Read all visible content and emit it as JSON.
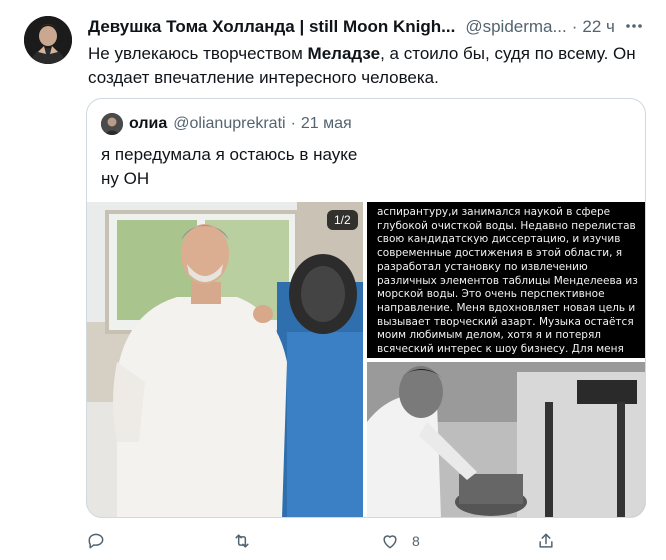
{
  "tweet": {
    "author_name": "Девушка Тома Холланда | still Moon Knigh...",
    "author_handle": "@spiderma...",
    "separator": "·",
    "time": "22 ч",
    "text_before": "Не увлекаюсь творчеством ",
    "text_bold": "Меладзе",
    "text_after": ", а стоило бы, судя по всему. Он создает впечатление интересного человека."
  },
  "quote": {
    "author_name": "олиа",
    "author_handle": "@olianuprekrati",
    "separator": "·",
    "time": "21 мая",
    "line1": "я передумала я остаюсь в науке",
    "line2": "ну ОН",
    "media_counter": "1/2",
    "story_text": "аспирантуру,и занимался наукой в сфере глубокой очисткой воды. Недавно перелистав свою кандидатскую диссертацию, и изучив современные достижения в этой области, я разработал установку по извлечению различных элементов таблицы Менделеева из морской воды. Это очень перспективное направление. Меня вдохновляет новая цель и вызывает творческий азарт. Музыка остаётся моим любимым делом, хотя я и потерял всяческий интерес к шоу бизнесу. Для меня перестали иметь значение форматы песен,"
  },
  "actions": {
    "reply_count": "",
    "retweet_count": "",
    "like_count": "8",
    "share_count": ""
  },
  "icons": {
    "more": "more-icon",
    "reply": "reply-icon",
    "retweet": "retweet-icon",
    "like": "heart-icon",
    "share": "share-icon"
  },
  "colors": {
    "text": "#0f1419",
    "secondary": "#536471",
    "border": "#cfd9de"
  }
}
